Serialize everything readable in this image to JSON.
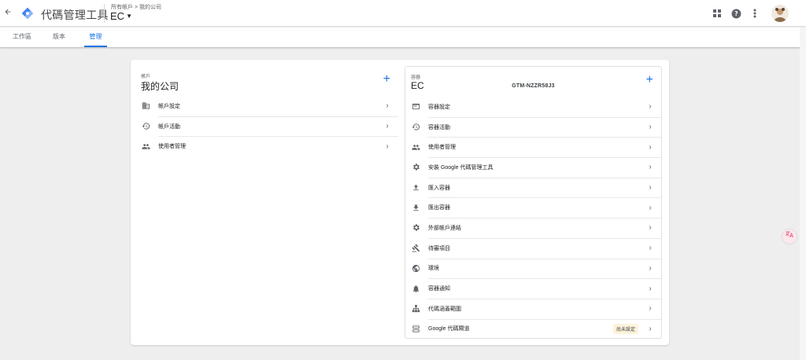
{
  "header": {
    "app_title": "代碼管理工具",
    "breadcrumb": "所有帳戶 > 我的公司",
    "container_name": "EC",
    "icons": [
      "apps-icon",
      "help-icon",
      "more-vert-icon",
      "avatar"
    ]
  },
  "tabs": [
    {
      "label": "工作區",
      "active": false
    },
    {
      "label": "版本",
      "active": false
    },
    {
      "label": "管理",
      "active": true
    }
  ],
  "account": {
    "section_label": "帳戶",
    "name": "我的公司",
    "items": [
      {
        "label": "帳戶設定",
        "icon": "building-icon"
      },
      {
        "label": "帳戶活動",
        "icon": "history-icon"
      },
      {
        "label": "使用者管理",
        "icon": "people-icon"
      }
    ]
  },
  "container": {
    "section_label": "容器",
    "name": "EC",
    "id": "GTM-NZZR58J3",
    "items": [
      {
        "label": "容器設定",
        "icon": "container-settings-icon"
      },
      {
        "label": "容器活動",
        "icon": "history-icon"
      },
      {
        "label": "使用者管理",
        "icon": "people-icon"
      },
      {
        "label": "安裝 Google 代碼管理工具",
        "icon": "gear-icon"
      },
      {
        "label": "匯入容器",
        "icon": "upload-icon"
      },
      {
        "label": "匯出容器",
        "icon": "download-icon"
      },
      {
        "label": "外部帳戶連結",
        "icon": "gear-icon"
      },
      {
        "label": "待審項目",
        "icon": "gavel-icon"
      },
      {
        "label": "環境",
        "icon": "globe-icon"
      },
      {
        "label": "容器通知",
        "icon": "bell-icon"
      },
      {
        "label": "代碼涵蓋範圍",
        "icon": "sitemap-icon"
      },
      {
        "label": "Google 代碼閘道",
        "icon": "gateway-icon",
        "badge": "尚未設定"
      }
    ]
  },
  "colors": {
    "accent": "#1a73e8",
    "badge_bg": "#fdf3da"
  }
}
